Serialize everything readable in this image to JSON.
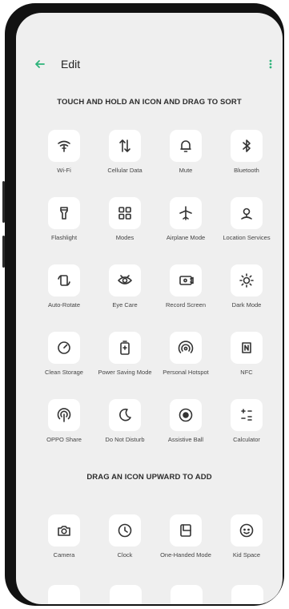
{
  "header": {
    "title": "Edit"
  },
  "sections": {
    "sort_hint": "TOUCH AND HOLD AN ICON AND DRAG TO SORT",
    "add_hint": "DRAG AN ICON UPWARD TO ADD"
  },
  "active_tiles": [
    {
      "label": "Wi-Fi",
      "icon": "wifi-icon"
    },
    {
      "label": "Cellular Data",
      "icon": "cellular-data-icon"
    },
    {
      "label": "Mute",
      "icon": "bell-icon"
    },
    {
      "label": "Bluetooth",
      "icon": "bluetooth-icon"
    },
    {
      "label": "Flashlight",
      "icon": "flashlight-icon"
    },
    {
      "label": "Modes",
      "icon": "modes-icon"
    },
    {
      "label": "Airplane Mode",
      "icon": "airplane-icon"
    },
    {
      "label": "Location Services",
      "icon": "location-icon"
    },
    {
      "label": "Auto-Rotate",
      "icon": "rotate-icon"
    },
    {
      "label": "Eye Care",
      "icon": "eye-icon"
    },
    {
      "label": "Record Screen",
      "icon": "record-screen-icon"
    },
    {
      "label": "Dark Mode",
      "icon": "dark-mode-icon"
    },
    {
      "label": "Clean Storage",
      "icon": "clean-storage-icon"
    },
    {
      "label": "Power Saving Mode",
      "icon": "battery-icon"
    },
    {
      "label": "Personal Hotspot",
      "icon": "hotspot-icon"
    },
    {
      "label": "NFC",
      "icon": "nfc-icon"
    },
    {
      "label": "OPPO Share",
      "icon": "share-icon"
    },
    {
      "label": "Do Not Disturb",
      "icon": "moon-icon"
    },
    {
      "label": "Assistive Ball",
      "icon": "assistive-ball-icon"
    },
    {
      "label": "Calculator",
      "icon": "calculator-icon"
    }
  ],
  "available_tiles": [
    {
      "label": "Camera",
      "icon": "camera-icon"
    },
    {
      "label": "Clock",
      "icon": "clock-icon"
    },
    {
      "label": "One-Handed Mode",
      "icon": "one-handed-icon"
    },
    {
      "label": "Kid Space",
      "icon": "kid-space-icon"
    }
  ],
  "colors": {
    "accent": "#2db37a",
    "background": "#efefef",
    "tile": "#ffffff"
  }
}
